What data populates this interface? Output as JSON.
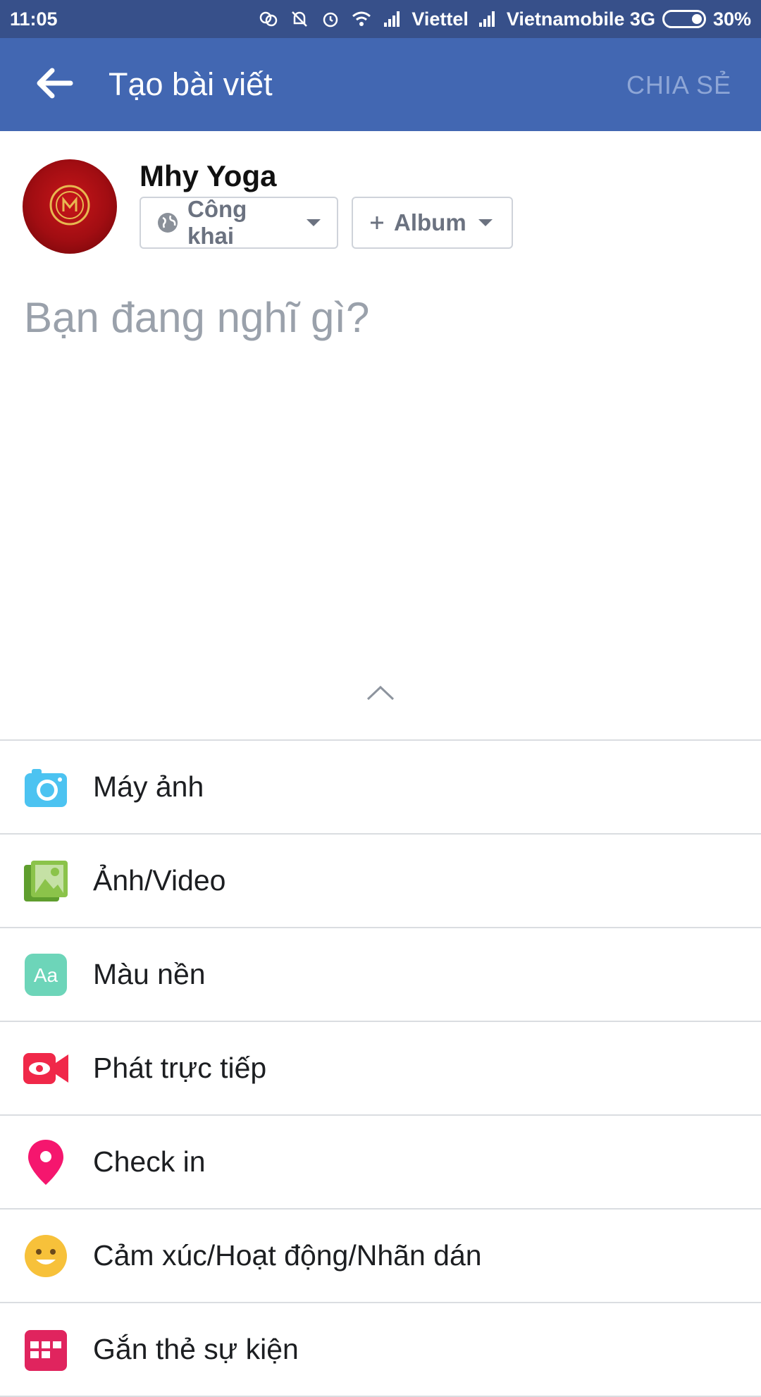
{
  "status_bar": {
    "time": "11:05",
    "carrier1": "Viettel",
    "carrier2": "Vietnamobile 3G",
    "battery": "30%",
    "battery_level": 0.3
  },
  "header": {
    "title": "Tạo bài viết",
    "share_label": "CHIA SẺ"
  },
  "author": {
    "name": "Mhy Yoga",
    "privacy_label": "Công khai",
    "album_label": "Album"
  },
  "composer": {
    "placeholder": "Bạn đang nghĩ gì?"
  },
  "menu": [
    {
      "label": "Máy ảnh",
      "icon": "camera-icon",
      "color": "#4cc3f1"
    },
    {
      "label": "Ảnh/Video",
      "icon": "photo-video-icon",
      "color": "#8bc34a"
    },
    {
      "label": "Màu nền",
      "icon": "background-color-icon",
      "color": "#6dd5b9"
    },
    {
      "label": "Phát trực tiếp",
      "icon": "live-video-icon",
      "color": "#f02849"
    },
    {
      "label": "Check in",
      "icon": "location-pin-icon",
      "color": "#f5166e"
    },
    {
      "label": "Cảm xúc/Hoạt động/Nhãn dán",
      "icon": "feeling-emoji-icon",
      "color": "#f7c13a"
    },
    {
      "label": "Gắn thẻ sự kiện",
      "icon": "event-calendar-icon",
      "color": "#e0245e"
    }
  ]
}
